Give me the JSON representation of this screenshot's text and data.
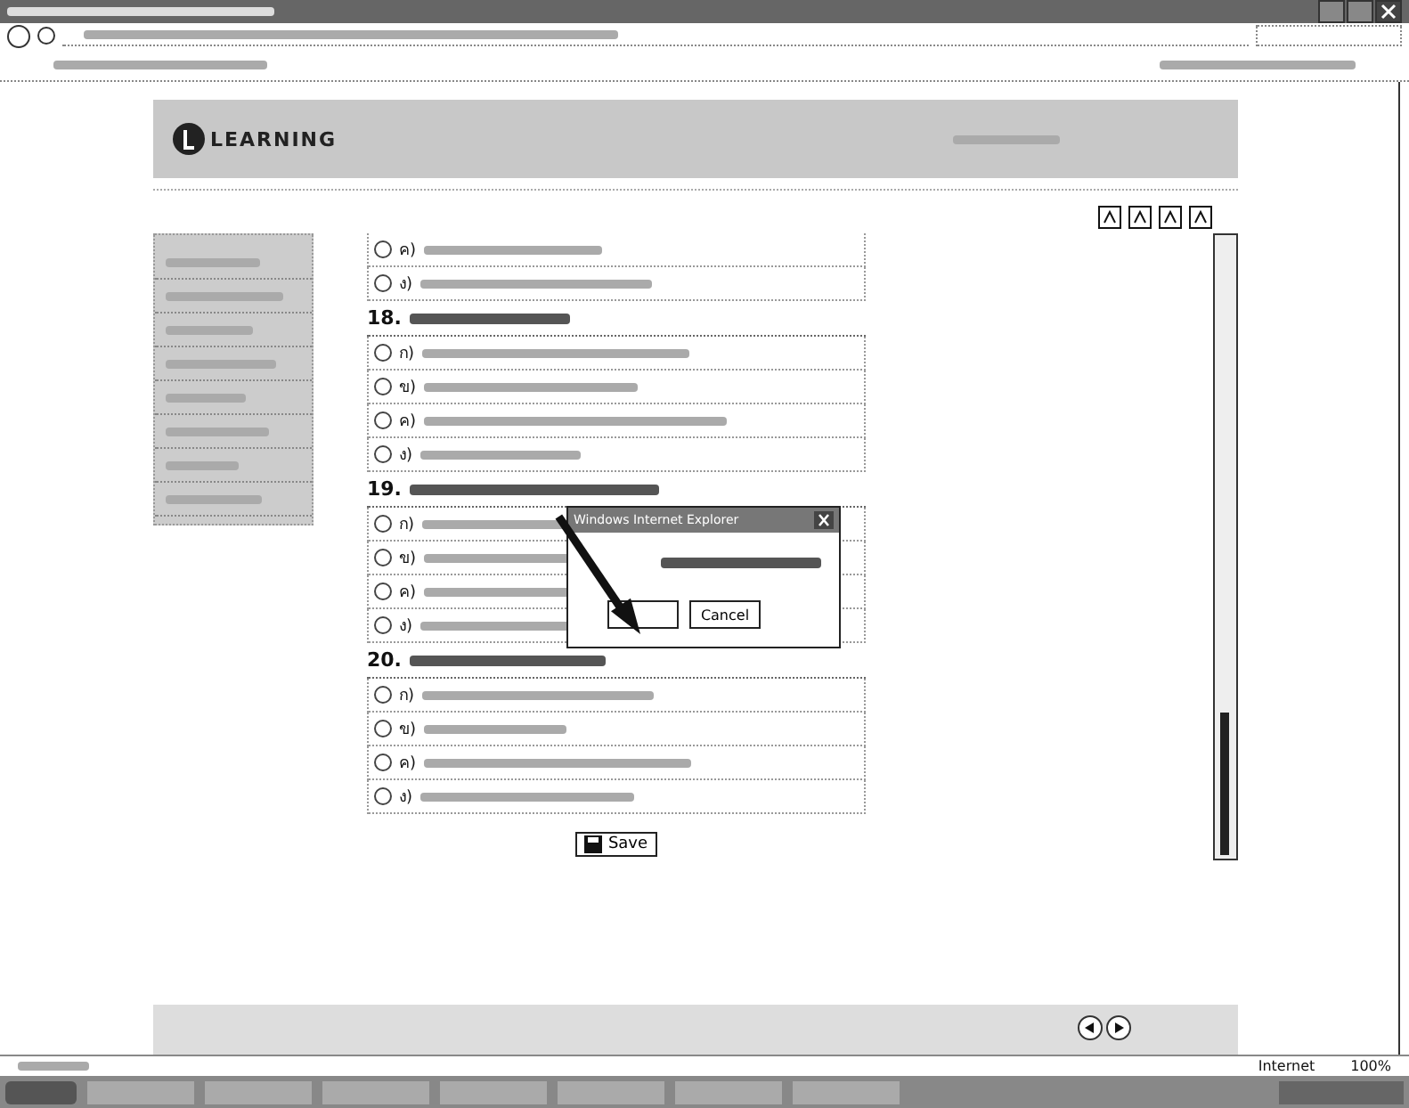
{
  "page": {
    "logo": "LEARNING"
  },
  "previous_options": [
    {
      "letter": "ค)",
      "selected": false
    },
    {
      "letter": "ง)",
      "selected": false
    }
  ],
  "questions": [
    {
      "number": "18.",
      "options": [
        {
          "letter": "ก)",
          "selected": false
        },
        {
          "letter": "ข)",
          "selected": false
        },
        {
          "letter": "ค)",
          "selected": false
        },
        {
          "letter": "ง)",
          "selected": false
        }
      ]
    },
    {
      "number": "19.",
      "options": [
        {
          "letter": "ก)",
          "selected": false
        },
        {
          "letter": "ข)",
          "selected": false
        },
        {
          "letter": "ค)",
          "selected": false
        },
        {
          "letter": "ง)",
          "selected": false
        }
      ]
    },
    {
      "number": "20.",
      "options": [
        {
          "letter": "ก)",
          "selected": false
        },
        {
          "letter": "ข)",
          "selected": false
        },
        {
          "letter": "ค)",
          "selected": false
        },
        {
          "letter": "ง)",
          "selected": false
        }
      ]
    }
  ],
  "save_button": "Save",
  "dialog": {
    "title": "Windows Internet Explorer",
    "cancel": "Cancel"
  },
  "status_bar": {
    "zone": "Internet",
    "zoom": "100%"
  }
}
